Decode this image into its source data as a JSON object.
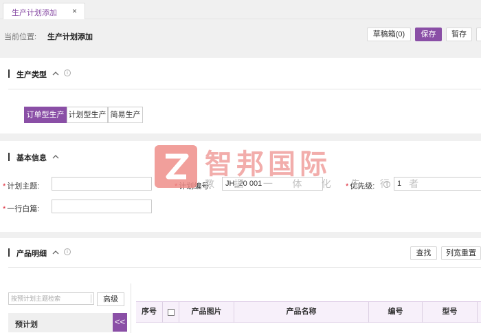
{
  "tab": {
    "label": "生产计划添加",
    "close": "×"
  },
  "breadcrumb": {
    "label": "当前位置:",
    "current": "生产计划添加"
  },
  "toolbar": {
    "drafts": "草稿箱(0)",
    "save": "保存",
    "temp_save": "暂存"
  },
  "production_type": {
    "title": "生产类型",
    "options": [
      "订单型生产",
      "计划型生产",
      "简易生产"
    ],
    "selected": "订单型生产"
  },
  "basic_info": {
    "title": "基本信息",
    "plan_subject": {
      "label": "计划主题:",
      "value": ""
    },
    "plan_number": {
      "label": "计划编号:",
      "value": "JH_20        001"
    },
    "priority": {
      "label": "优先级:",
      "value": "1"
    },
    "one_line_note": {
      "label": "一行白篇:",
      "value": ""
    }
  },
  "product_detail": {
    "title": "产品明细",
    "find_button": "查找",
    "reset_width_button": "列宽重置",
    "search_placeholder": "按预计划主题检索",
    "advanced_button": "高级",
    "pre_plan_title": "预计划",
    "collapse_symbol": "<<",
    "columns": [
      "序号",
      "",
      "产品图片",
      "产品名称",
      "编号",
      "型号"
    ]
  },
  "watermark": {
    "brand": "智邦国际",
    "slogan": "数 据 一 体 化 先 行 者"
  },
  "colors": {
    "accent": "#8a4fa6",
    "watermark": "#ef8a86"
  }
}
